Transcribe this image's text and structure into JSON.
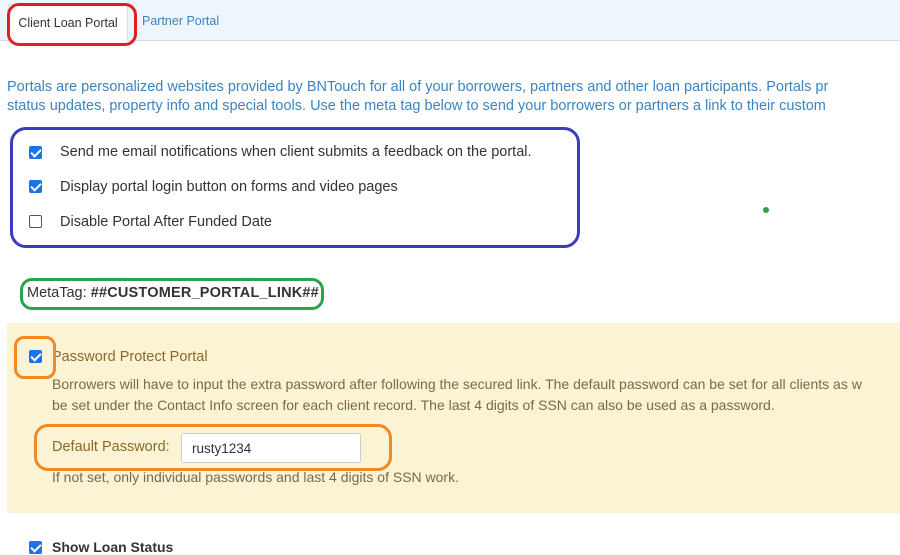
{
  "tabs": {
    "active_label": "Client Loan Portal",
    "inactive_label": "Partner Portal"
  },
  "intro": {
    "line1": "Portals are personalized websites provided by BNTouch for all of your borrowers, partners and other loan participants. Portals pr",
    "line2": "status updates, property info and special tools. Use the meta tag below to send your borrowers or partners a link to their custom"
  },
  "options": [
    {
      "label": "Send me email notifications when client submits a feedback on the portal.",
      "checked": true
    },
    {
      "label": "Display portal login button on forms and video pages",
      "checked": true
    },
    {
      "label": "Disable Portal After Funded Date",
      "checked": false
    }
  ],
  "metatag": {
    "label": "MetaTag:",
    "value": "##CUSTOMER_PORTAL_LINK##"
  },
  "password_protect": {
    "label": "Password Protect Portal",
    "checked": true,
    "desc_line1": "Borrowers will have to input the extra password after following the secured link. The default password can be set for all clients as w",
    "desc_line2": "be set under the Contact Info screen for each client record. The last 4 digits of SSN can also be used as a password.",
    "default_password_label": "Default Password:",
    "default_password_value": "rusty1234",
    "note": "If not set, only individual passwords and last 4 digits of SSN work."
  },
  "show_loan_status": {
    "label": "Show Loan Status",
    "checked": true
  },
  "colors": {
    "link_blue": "#3a84c4",
    "checkbox_blue": "#1a73e8",
    "highlight_yellow": "#fcf3d4",
    "annotation_red": "#e02020",
    "annotation_blue": "#3c3cc0",
    "annotation_green": "#2aa34a",
    "annotation_orange": "#f08a24"
  }
}
